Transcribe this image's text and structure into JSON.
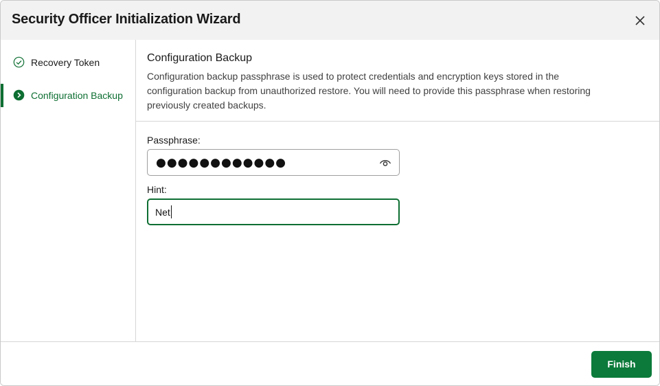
{
  "dialog": {
    "title": "Security Officer Initialization Wizard"
  },
  "sidebar": {
    "items": [
      {
        "label": "Recovery Token",
        "icon": "check-circle-icon",
        "state": "completed"
      },
      {
        "label": "Configuration Backup",
        "icon": "chevron-right-circle-icon",
        "state": "active"
      }
    ]
  },
  "main": {
    "title": "Configuration Backup",
    "description": "Configuration backup passphrase is used to protect credentials and encryption keys stored in the configuration backup from unauthorized restore. You will need to provide this passphrase when restoring previously created backups.",
    "passphrase": {
      "label": "Passphrase:",
      "masked_value": "●●●●●●●●●●●●",
      "reveal_icon": "eye-icon"
    },
    "hint": {
      "label": "Hint:",
      "value": "Net"
    }
  },
  "footer": {
    "finish_label": "Finish"
  },
  "colors": {
    "accent": "#0d6e32",
    "button": "#0b7a3a",
    "titlebar": "#f2f2f2",
    "border": "#d6d6d6"
  }
}
